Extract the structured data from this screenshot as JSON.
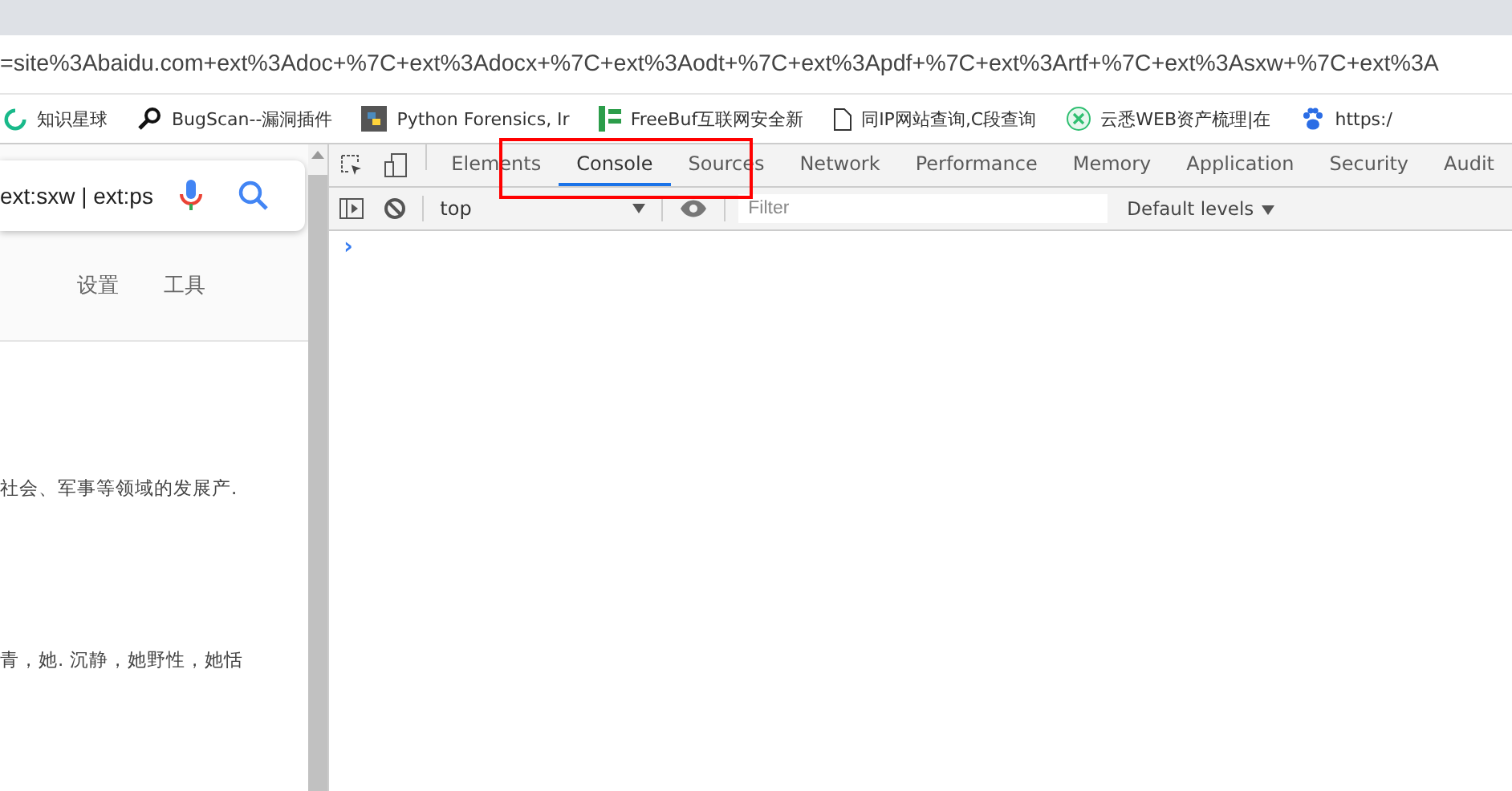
{
  "address_bar": {
    "url": "=site%3Abaidu.com+ext%3Adoc+%7C+ext%3Adocx+%7C+ext%3Aodt+%7C+ext%3Apdf+%7C+ext%3Artf+%7C+ext%3Asxw+%7C+ext%3A"
  },
  "bookmarks": [
    {
      "label": "知识星球",
      "kind": "ring"
    },
    {
      "label": "BugScan--漏洞插件",
      "kind": "magnifier"
    },
    {
      "label": "Python Forensics, Ir",
      "kind": "python"
    },
    {
      "label": "FreeBuf互联网安全新",
      "kind": "freebuf"
    },
    {
      "label": "同IP网站查询,C段查询",
      "kind": "page"
    },
    {
      "label": "云悉WEB资产梳理|在",
      "kind": "shield"
    },
    {
      "label": "https:/",
      "kind": "paw"
    }
  ],
  "page": {
    "search_value": "ext:sxw | ext:ps",
    "links": [
      "设置",
      "工具"
    ],
    "snippets": [
      "社会、军事等领域的发展产.",
      "青，她. 沉静，她野性，她恬"
    ]
  },
  "devtools": {
    "tabs": [
      {
        "label": "Elements",
        "selected": false
      },
      {
        "label": "Console",
        "selected": true
      },
      {
        "label": "Sources",
        "selected": false
      },
      {
        "label": "Network",
        "selected": false
      },
      {
        "label": "Performance",
        "selected": false
      },
      {
        "label": "Memory",
        "selected": false
      },
      {
        "label": "Application",
        "selected": false
      },
      {
        "label": "Security",
        "selected": false
      },
      {
        "label": "Audit",
        "selected": false
      }
    ],
    "context": "top",
    "filter_placeholder": "Filter",
    "levels": "Default levels",
    "prompt": "›"
  }
}
